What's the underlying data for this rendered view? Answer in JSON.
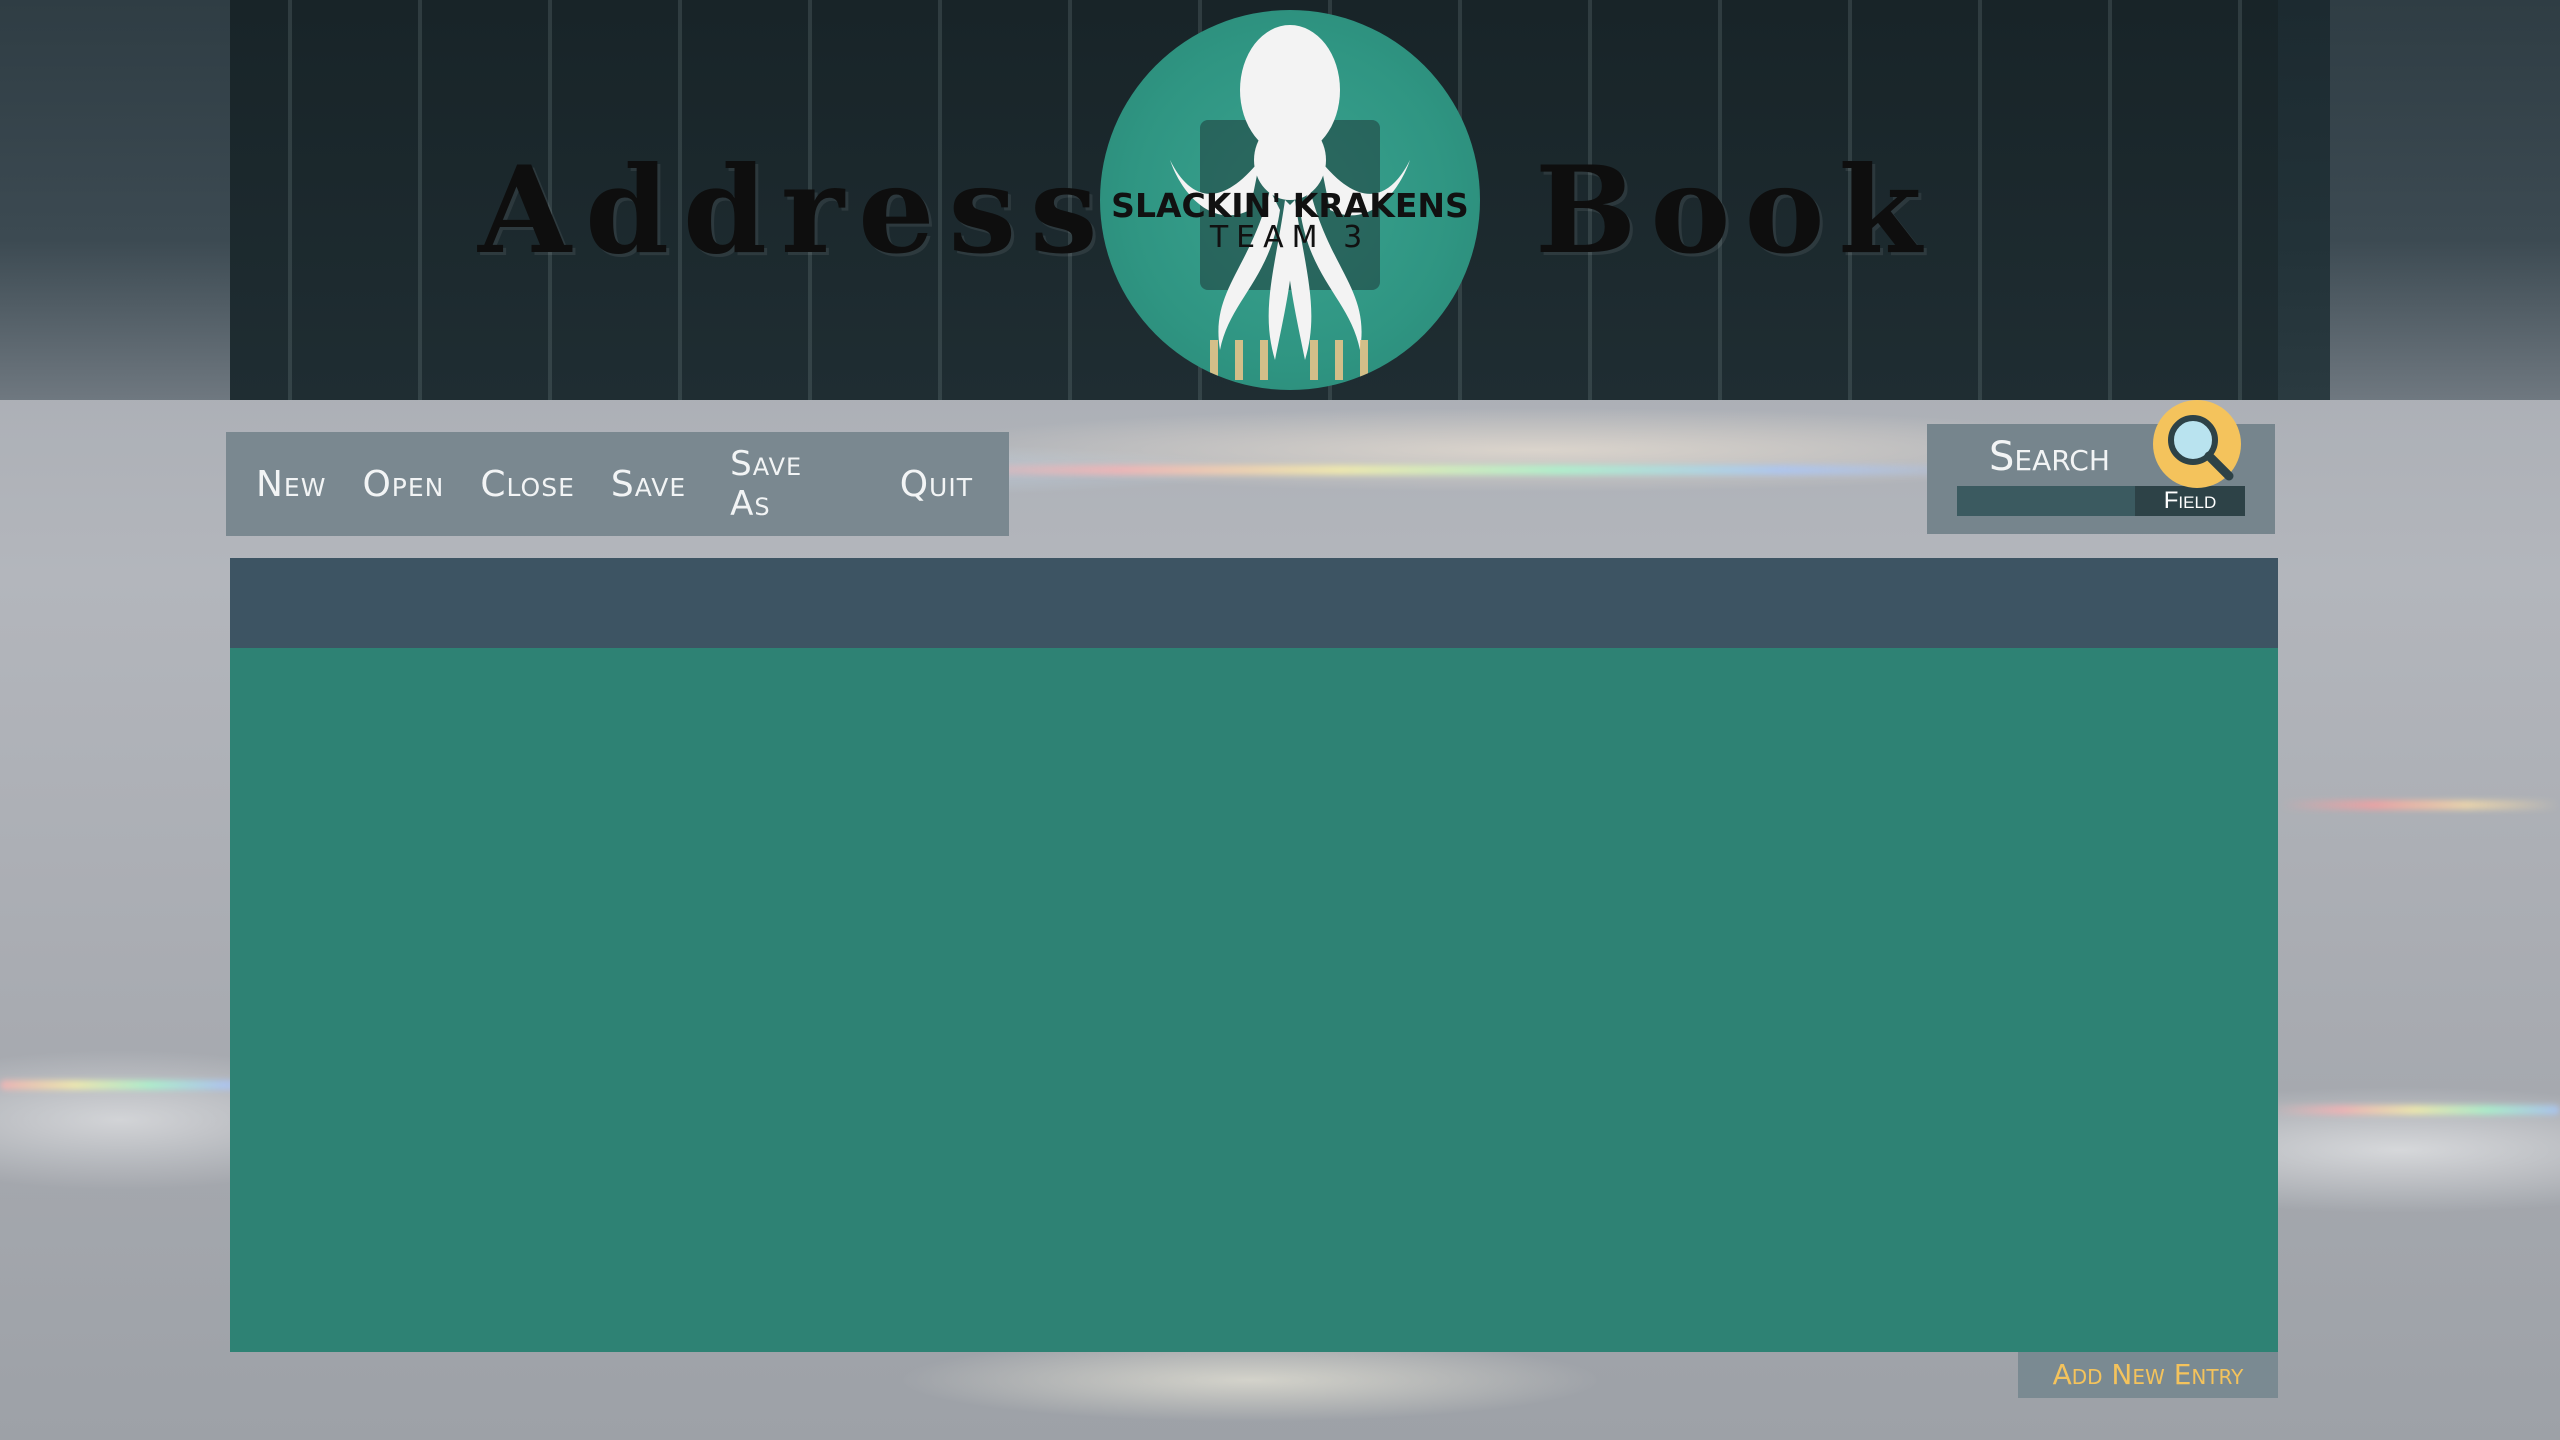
{
  "header": {
    "title_left": "Address",
    "title_right": "Book",
    "logo": {
      "line1": "SLACKIN' KRAKENS",
      "line2": "TEAM 3"
    }
  },
  "menu": {
    "items": [
      {
        "label": "New"
      },
      {
        "label": "Open"
      },
      {
        "label": "Close"
      },
      {
        "label": "Save"
      },
      {
        "label": "Save As"
      },
      {
        "label": "Quit"
      }
    ]
  },
  "search": {
    "label": "Search",
    "field_tag": "Field",
    "value": "",
    "placeholder": ""
  },
  "table": {
    "rows": []
  },
  "actions": {
    "add_entry": "Add New Entry"
  },
  "colors": {
    "toolbar": "#7a8890",
    "table_header": "#3d5463",
    "table_body": "#2e8274",
    "accent": "#f4c35c"
  }
}
